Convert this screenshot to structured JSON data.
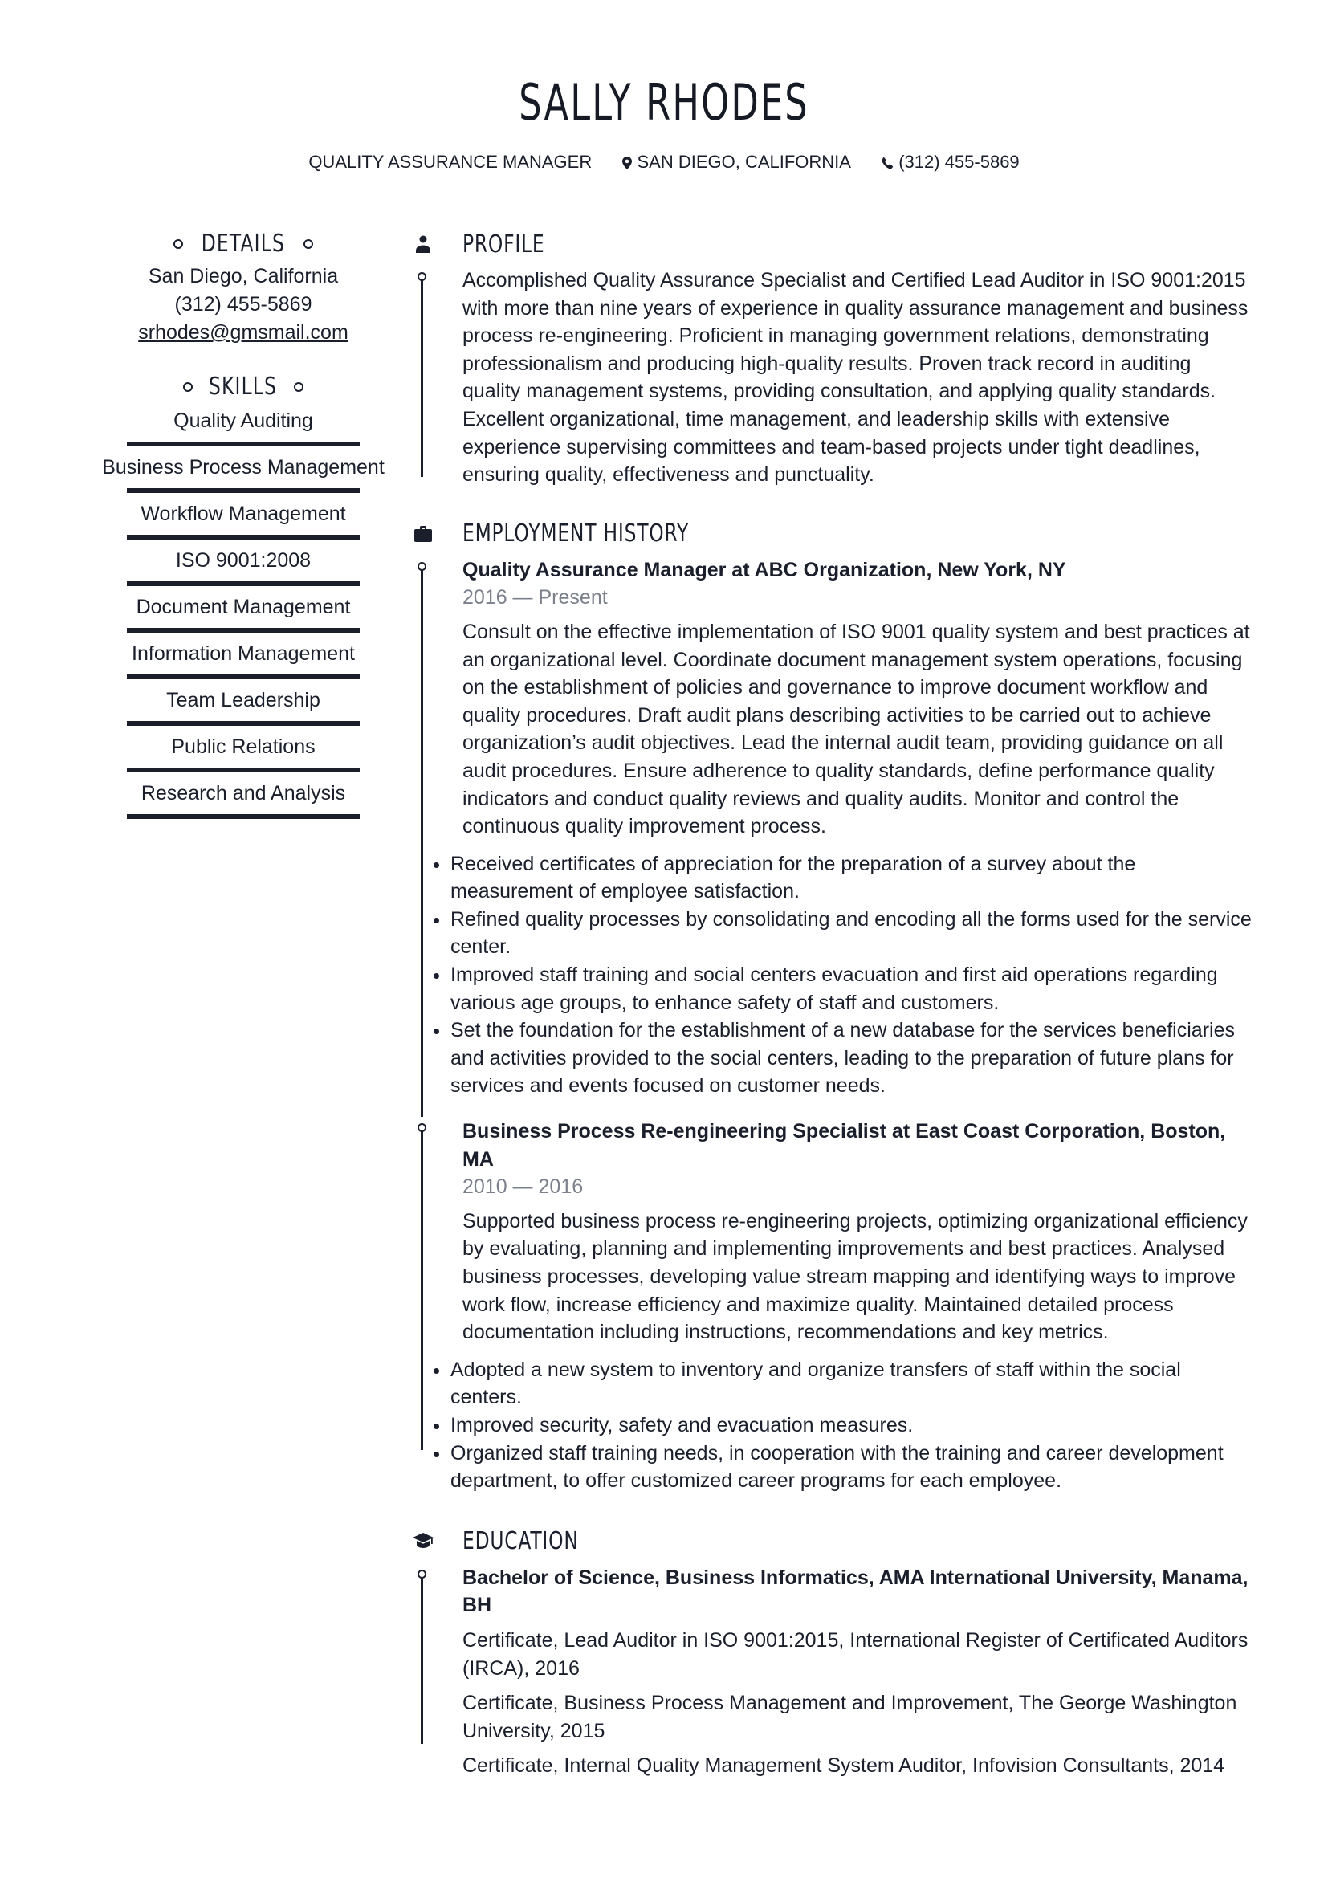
{
  "header": {
    "name": "SALLY RHODES",
    "job_title": "QUALITY ASSURANCE MANAGER",
    "location": "SAN DIEGO, CALIFORNIA",
    "phone": "(312) 455-5869",
    "location_icon": "map-pin-icon",
    "phone_icon": "phone-icon"
  },
  "sidebar": {
    "details": {
      "heading": "DETAILS",
      "address": "San Diego, California",
      "phone": "(312) 455-5869",
      "email": "srhodes@gmsmail.com"
    },
    "skills": {
      "heading": "SKILLS",
      "items": [
        {
          "label": "Quality Auditing",
          "level": 1.0
        },
        {
          "label": "Business Process Management",
          "level": 1.0
        },
        {
          "label": "Workflow Management",
          "level": 1.0
        },
        {
          "label": "ISO 9001:2008",
          "level": 1.0
        },
        {
          "label": "Document Management",
          "level": 1.0
        },
        {
          "label": "Information Management",
          "level": 1.0
        },
        {
          "label": "Team Leadership",
          "level": 1.0
        },
        {
          "label": "Public Relations",
          "level": 1.0
        },
        {
          "label": "Research and Analysis",
          "level": 1.0
        }
      ]
    }
  },
  "profile": {
    "heading": "PROFILE",
    "icon": "person-icon",
    "text": "Accomplished Quality Assurance Specialist and Certified Lead Auditor in ISO 9001:2015 with more than nine years of experience in quality assurance management and business process re-engineering. Proficient in managing government relations, demonstrating professionalism and producing high-quality results. Proven track record in auditing quality management systems, providing consultation, and applying quality standards. Excellent organizational, time management, and leadership skills with extensive experience supervising committees and team-based projects under tight deadlines, ensuring quality, effectiveness and punctuality."
  },
  "employment": {
    "heading": "EMPLOYMENT HISTORY",
    "icon": "briefcase-icon",
    "jobs": [
      {
        "title": "Quality Assurance Manager at ABC Organization, New York, NY",
        "dates": "2016 — Present",
        "description": "Consult on the effective implementation of ISO 9001 quality system and best practices at an organizational level. Coordinate document management system operations, focusing on the establishment of policies and governance to improve document workflow and quality procedures. Draft audit plans describing activities to be carried out to achieve organization’s audit objectives. Lead the internal audit team, providing guidance on all audit procedures. Ensure adherence to quality standards, define performance quality indicators and conduct quality reviews and quality audits. Monitor and control the continuous quality improvement process.",
        "bullets": [
          "Received certificates of appreciation for the preparation of a survey about the measurement of employee satisfaction.",
          "Refined quality processes by consolidating and encoding all the forms used for the service center.",
          "Improved staff training and social centers evacuation and first aid operations regarding various age groups, to enhance safety of staff and customers.",
          "Set the foundation for the establishment of a new database for the services beneficiaries and activities provided to the social centers, leading to the preparation of future plans for services and events focused on customer needs."
        ]
      },
      {
        "title": "Business Process Re-engineering Specialist at East Coast Corporation, Boston, MA",
        "dates": "2010 — 2016",
        "description": "Supported business process re-engineering projects, optimizing organizational efficiency by evaluating, planning and implementing improvements and best practices. Analysed business processes, developing value stream mapping and identifying ways to improve work flow, increase efficiency and maximize quality. Maintained detailed process documentation including instructions, recommendations and key metrics.",
        "bullets": [
          "Adopted a new system to inventory and organize transfers of staff within the social centers.",
          "Improved security, safety and evacuation measures.",
          "Organized staff training needs, in cooperation with the training and career development department, to offer customized career programs for each employee."
        ]
      }
    ]
  },
  "education": {
    "heading": "EDUCATION",
    "icon": "graduation-cap-icon",
    "degree": "Bachelor of Science, Business Informatics, AMA International University, Manama, BH",
    "items": [
      "Certificate, Lead Auditor in ISO 9001:2015, International Register of Certificated Auditors (IRCA), 2016",
      "Certificate, Business Process Management and Improvement, The George Washington University, 2015",
      "Certificate, Internal Quality Management System Auditor, Infovision Consultants, 2014"
    ]
  }
}
